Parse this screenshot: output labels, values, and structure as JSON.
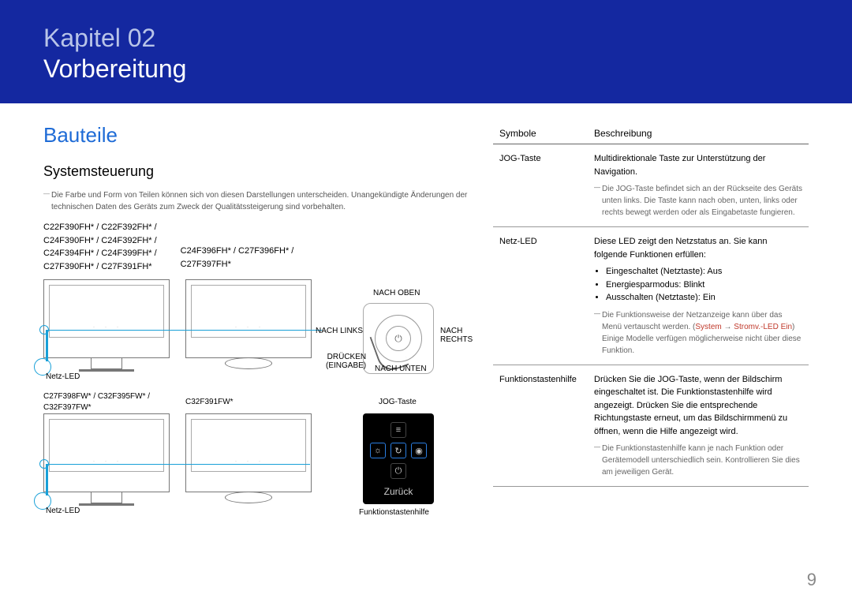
{
  "header": {
    "chapter": "Kapitel 02",
    "subtitle": "Vorbereitung"
  },
  "section_blue": "Bauteile",
  "section_black": "Systemsteuerung",
  "note_top": "Die Farbe und Form von Teilen können sich von diesen Darstellungen unterscheiden. Unangekündigte Änderungen der technischen Daten des Geräts zum Zweck der Qualitätssteigerung sind vorbehalten.",
  "models": {
    "col1": [
      "C22F390FH* / C22F392FH* /",
      "C24F390FH* / C24F392FH* /",
      "C24F394FH* / C24F399FH* /",
      "C27F390FH* / C27F391FH*"
    ],
    "col2": [
      "C24F396FH* / C27F396FH* /",
      "C27F397FH*"
    ],
    "row2_col1": "C27F398FW* / C32F395FW* / C32F397FW*",
    "row2_col2": "C32F391FW*"
  },
  "diagram_labels": {
    "netz_led": "Netz-LED",
    "nach_oben": "NACH OBEN",
    "nach_links": "NACH LINKS",
    "nach_rechts": "NACH RECHTS",
    "druecken": "DRÜCKEN",
    "eingabe": "(EINGABE)",
    "nach_unten": "NACH UNTEN",
    "jog_taste": "JOG-Taste",
    "funktionstastenhilfe": "Funktionstastenhilfe",
    "zurueck": "Zurück"
  },
  "table": {
    "th1": "Symbole",
    "th2": "Beschreibung",
    "rows": [
      {
        "label": "JOG-Taste",
        "main": "Multidirektionale Taste zur Unterstützung der Navigation.",
        "note": "Die JOG-Taste befindet sich an der Rückseite des Geräts unten links. Die Taste kann nach oben, unten, links oder rechts bewegt werden oder als Eingabetaste fungieren."
      },
      {
        "label": "Netz-LED",
        "main": "Diese LED zeigt den Netzstatus an. Sie kann folgende Funktionen erfüllen:",
        "bullets": [
          "Eingeschaltet (Netztaste): Aus",
          "Energiesparmodus: Blinkt",
          "Ausschalten (Netztaste): Ein"
        ],
        "note_pre": "Die Funktionsweise der Netzanzeige kann über das Menü vertauscht werden. (",
        "note_hl1": "System",
        "note_arrow": " → ",
        "note_hl2": "Stromv.-LED Ein",
        "note_post": ") Einige Modelle verfügen möglicherweise nicht über diese Funktion."
      },
      {
        "label": "Funktionstastenhilfe",
        "main": "Drücken Sie die JOG-Taste, wenn der Bildschirm eingeschaltet ist. Die Funktionstastenhilfe wird angezeigt. Drücken Sie die entsprechende Richtungstaste erneut, um das Bildschirmmenü zu öffnen, wenn die Hilfe angezeigt wird.",
        "note": "Die Funktionstastenhilfe kann je nach Funktion oder Gerätemodell unterschiedlich sein. Kontrollieren Sie dies am jeweiligen Gerät."
      }
    ]
  },
  "page_number": "9"
}
